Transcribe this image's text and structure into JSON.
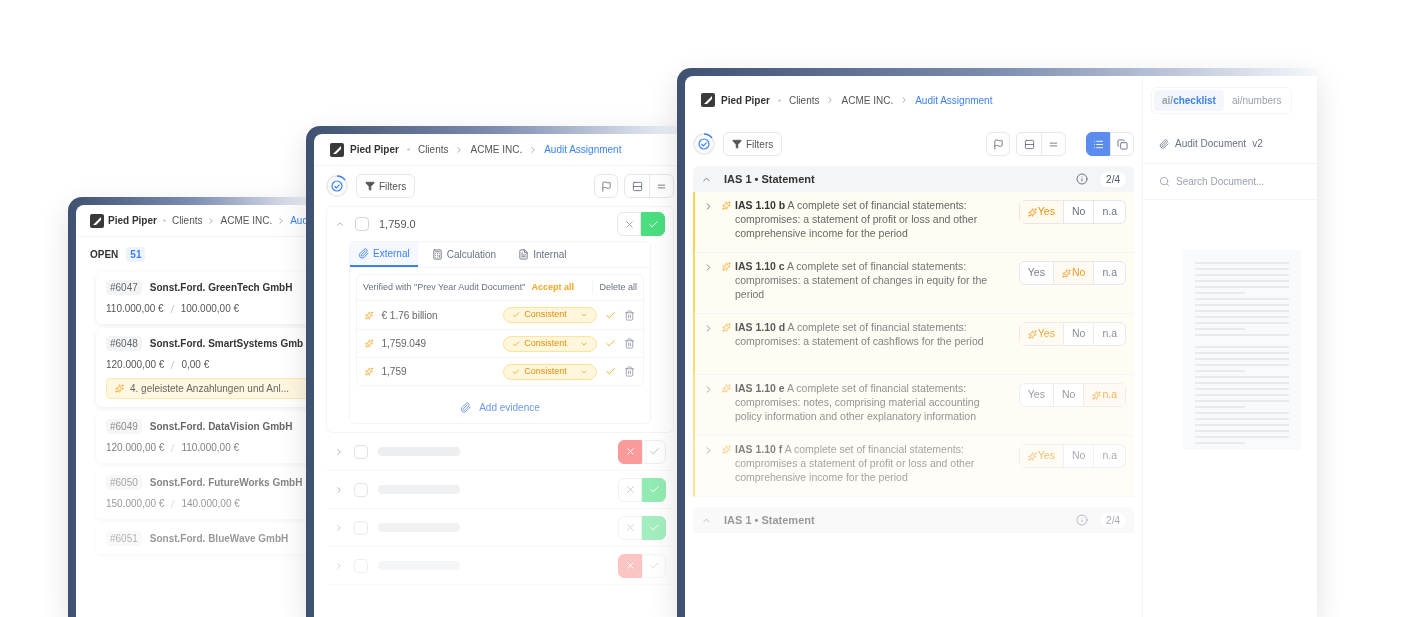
{
  "list_window": {
    "breadcrumb": {
      "brand": "Pied Piper",
      "items": [
        {
          "label": "Clients",
          "selected": false
        },
        {
          "label": "ACME INC.",
          "selected": false
        },
        {
          "label": "Aud",
          "selected": true
        }
      ]
    },
    "open_label": "OPEN",
    "open_count": "51",
    "items": [
      {
        "id": "#6047",
        "name": "Sonst.Ford. GreenTech GmbH",
        "amount": "110.000,00 €",
        "target": "100.000,00 €"
      },
      {
        "id": "#6048",
        "name": "Sonst.Ford. SmartSystems Gmb",
        "amount": "120.000,00 €",
        "target": "0,00 €",
        "suggestion": "4. geleistete Anzahlungen und Anl..."
      },
      {
        "id": "#6049",
        "name": "Sonst.Ford. DataVision GmbH",
        "amount": "120.000,00 €",
        "target": "110.000,00 €"
      },
      {
        "id": "#6050",
        "name": "Sonst.Ford. FutureWorks GmbH",
        "amount": "150.000,00 €",
        "target": "140.000,00 €"
      },
      {
        "id": "#6051",
        "name": "Sonst.Ford. BlueWave GmbH"
      }
    ]
  },
  "evidence_window": {
    "breadcrumb": {
      "brand": "Pied Piper",
      "items": [
        {
          "label": "Clients",
          "selected": false
        },
        {
          "label": "ACME INC.",
          "selected": false
        },
        {
          "label": "Audit Assignment",
          "selected": true
        }
      ]
    },
    "filters": "Filters",
    "item": {
      "value": "1,759.0",
      "checked": false,
      "accepted": true,
      "rejected": false
    },
    "tabs": [
      {
        "label": "External",
        "kind": "clip",
        "selected": true
      },
      {
        "label": "Calculation",
        "kind": "calc",
        "selected": false
      },
      {
        "label": "Internal",
        "kind": "doc",
        "selected": false
      }
    ],
    "verified": "Verified with \"Prev Year Audit Document\"",
    "accept_all": "Accept all",
    "delete_all": "Delete all",
    "evidence": [
      {
        "value": "€ 1.76 billion",
        "status": "Consistent"
      },
      {
        "value": "1,759.049",
        "status": "Consistent"
      },
      {
        "value": "1,759",
        "status": "Consistent"
      }
    ],
    "add_evidence": "Add evidence",
    "other_items": [
      {
        "checked": false,
        "accepted": false,
        "rejected": true
      },
      {
        "checked": false,
        "accepted": true,
        "rejected": false
      },
      {
        "checked": false,
        "accepted": true,
        "rejected": false
      },
      {
        "checked": false,
        "accepted": false,
        "rejected": true
      }
    ]
  },
  "checklist_window": {
    "breadcrumb": {
      "brand": "Pied Piper",
      "items": [
        {
          "label": "Clients",
          "selected": false
        },
        {
          "label": "ACME INC.",
          "selected": false
        },
        {
          "label": "Audit Assignment",
          "selected": true
        }
      ]
    },
    "modes": [
      {
        "prefix": "ai/",
        "label": "checklist",
        "selected": true
      },
      {
        "prefix": "ai/",
        "label": "numbers",
        "selected": false
      }
    ],
    "filters": "Filters",
    "views": [
      {
        "kind": "list",
        "selected": true
      },
      {
        "kind": "cards",
        "selected": false
      }
    ],
    "sections": [
      {
        "title": "IAS 1 • Statement",
        "count": "2/4",
        "items": [
          {
            "code": "IAS 1.10 b",
            "text": "A complete set of financial statements: compromises: a statement of profit or loss and other comprehensive income for the period",
            "options": [
              {
                "label": "Yes",
                "selected": true
              },
              {
                "label": "No",
                "selected": false
              },
              {
                "label": "n.a",
                "selected": false
              }
            ]
          },
          {
            "code": "IAS 1.10 c",
            "text": "A complete set of financial statements: compromises: a statement of changes in equity for the period",
            "options": [
              {
                "label": "Yes",
                "selected": false
              },
              {
                "label": "No",
                "selected": true
              },
              {
                "label": "n.a",
                "selected": false
              }
            ]
          },
          {
            "code": "IAS 1.10 d",
            "text": "A complete set of financial statements: compromises: a statement of cashflows for the period",
            "options": [
              {
                "label": "Yes",
                "selected": true
              },
              {
                "label": "No",
                "selected": false
              },
              {
                "label": "n.a",
                "selected": false
              }
            ]
          },
          {
            "code": "IAS 1.10 e",
            "text": "A complete set of financial statements: compromises: notes, comprising material accounting policy information and other explanatory information",
            "options": [
              {
                "label": "Yes",
                "selected": false
              },
              {
                "label": "No",
                "selected": false
              },
              {
                "label": "n.a",
                "selected": true
              }
            ]
          },
          {
            "code": "IAS 1.10 f",
            "text": "A complete set of financial statements: compromises a statement of profit or loss and other comprehensive income for the period",
            "options": [
              {
                "label": "Yes",
                "selected": true
              },
              {
                "label": "No",
                "selected": false
              },
              {
                "label": "n.a",
                "selected": false
              }
            ]
          }
        ]
      },
      {
        "title": "IAS 1 • Statement",
        "count": "2/4"
      }
    ],
    "document": {
      "title": "Audit Document",
      "version": "v2",
      "search_placeholder": "Search Document..."
    }
  }
}
